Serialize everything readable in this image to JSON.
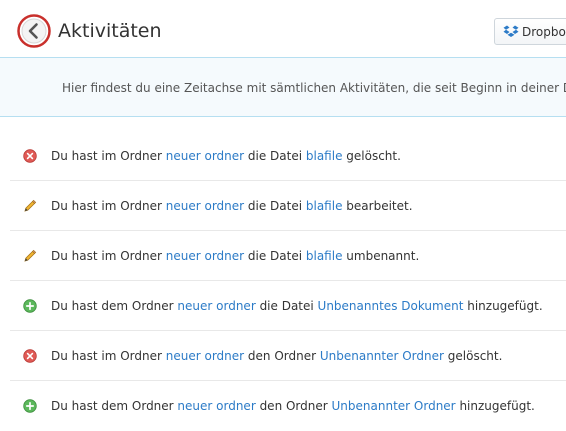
{
  "header": {
    "title": "Aktivitäten",
    "dropbox_label": "Dropbox"
  },
  "info": {
    "text": "Hier findest du eine Zeitachse mit sämtlichen Aktivitäten, die seit Beginn in deiner Dropbox"
  },
  "colors": {
    "link": "#2c7bc7",
    "deleted_icon": "#d9534f",
    "edited_icon": "#e8a317",
    "added_icon": "#5cb85c",
    "info_background": "#f5fafd"
  },
  "activities": [
    {
      "icon": "deleted-icon",
      "t1": "Du hast im Ordner ",
      "link1": "neuer ordner",
      "t2": " die Datei ",
      "link2": "blafile",
      "t3": " gelöscht."
    },
    {
      "icon": "pencil-icon",
      "t1": "Du hast im Ordner ",
      "link1": "neuer ordner",
      "t2": " die Datei ",
      "link2": "blafile",
      "t3": " bearbeitet."
    },
    {
      "icon": "pencil-icon",
      "t1": "Du hast im Ordner ",
      "link1": "neuer ordner",
      "t2": " die Datei ",
      "link2": "blafile",
      "t3": " umbenannt."
    },
    {
      "icon": "added-icon",
      "t1": "Du hast dem Ordner ",
      "link1": "neuer ordner",
      "t2": " die Datei ",
      "link2": "Unbenanntes Dokument",
      "t3": " hinzugefügt."
    },
    {
      "icon": "deleted-icon",
      "t1": "Du hast im Ordner ",
      "link1": "neuer ordner",
      "t2": " den Ordner ",
      "link2": "Unbenannter Ordner",
      "t3": " gelöscht."
    },
    {
      "icon": "added-icon",
      "t1": "Du hast dem Ordner ",
      "link1": "neuer ordner",
      "t2": " den Ordner ",
      "link2": "Unbenannter Ordner",
      "t3": " hinzugefügt."
    }
  ]
}
